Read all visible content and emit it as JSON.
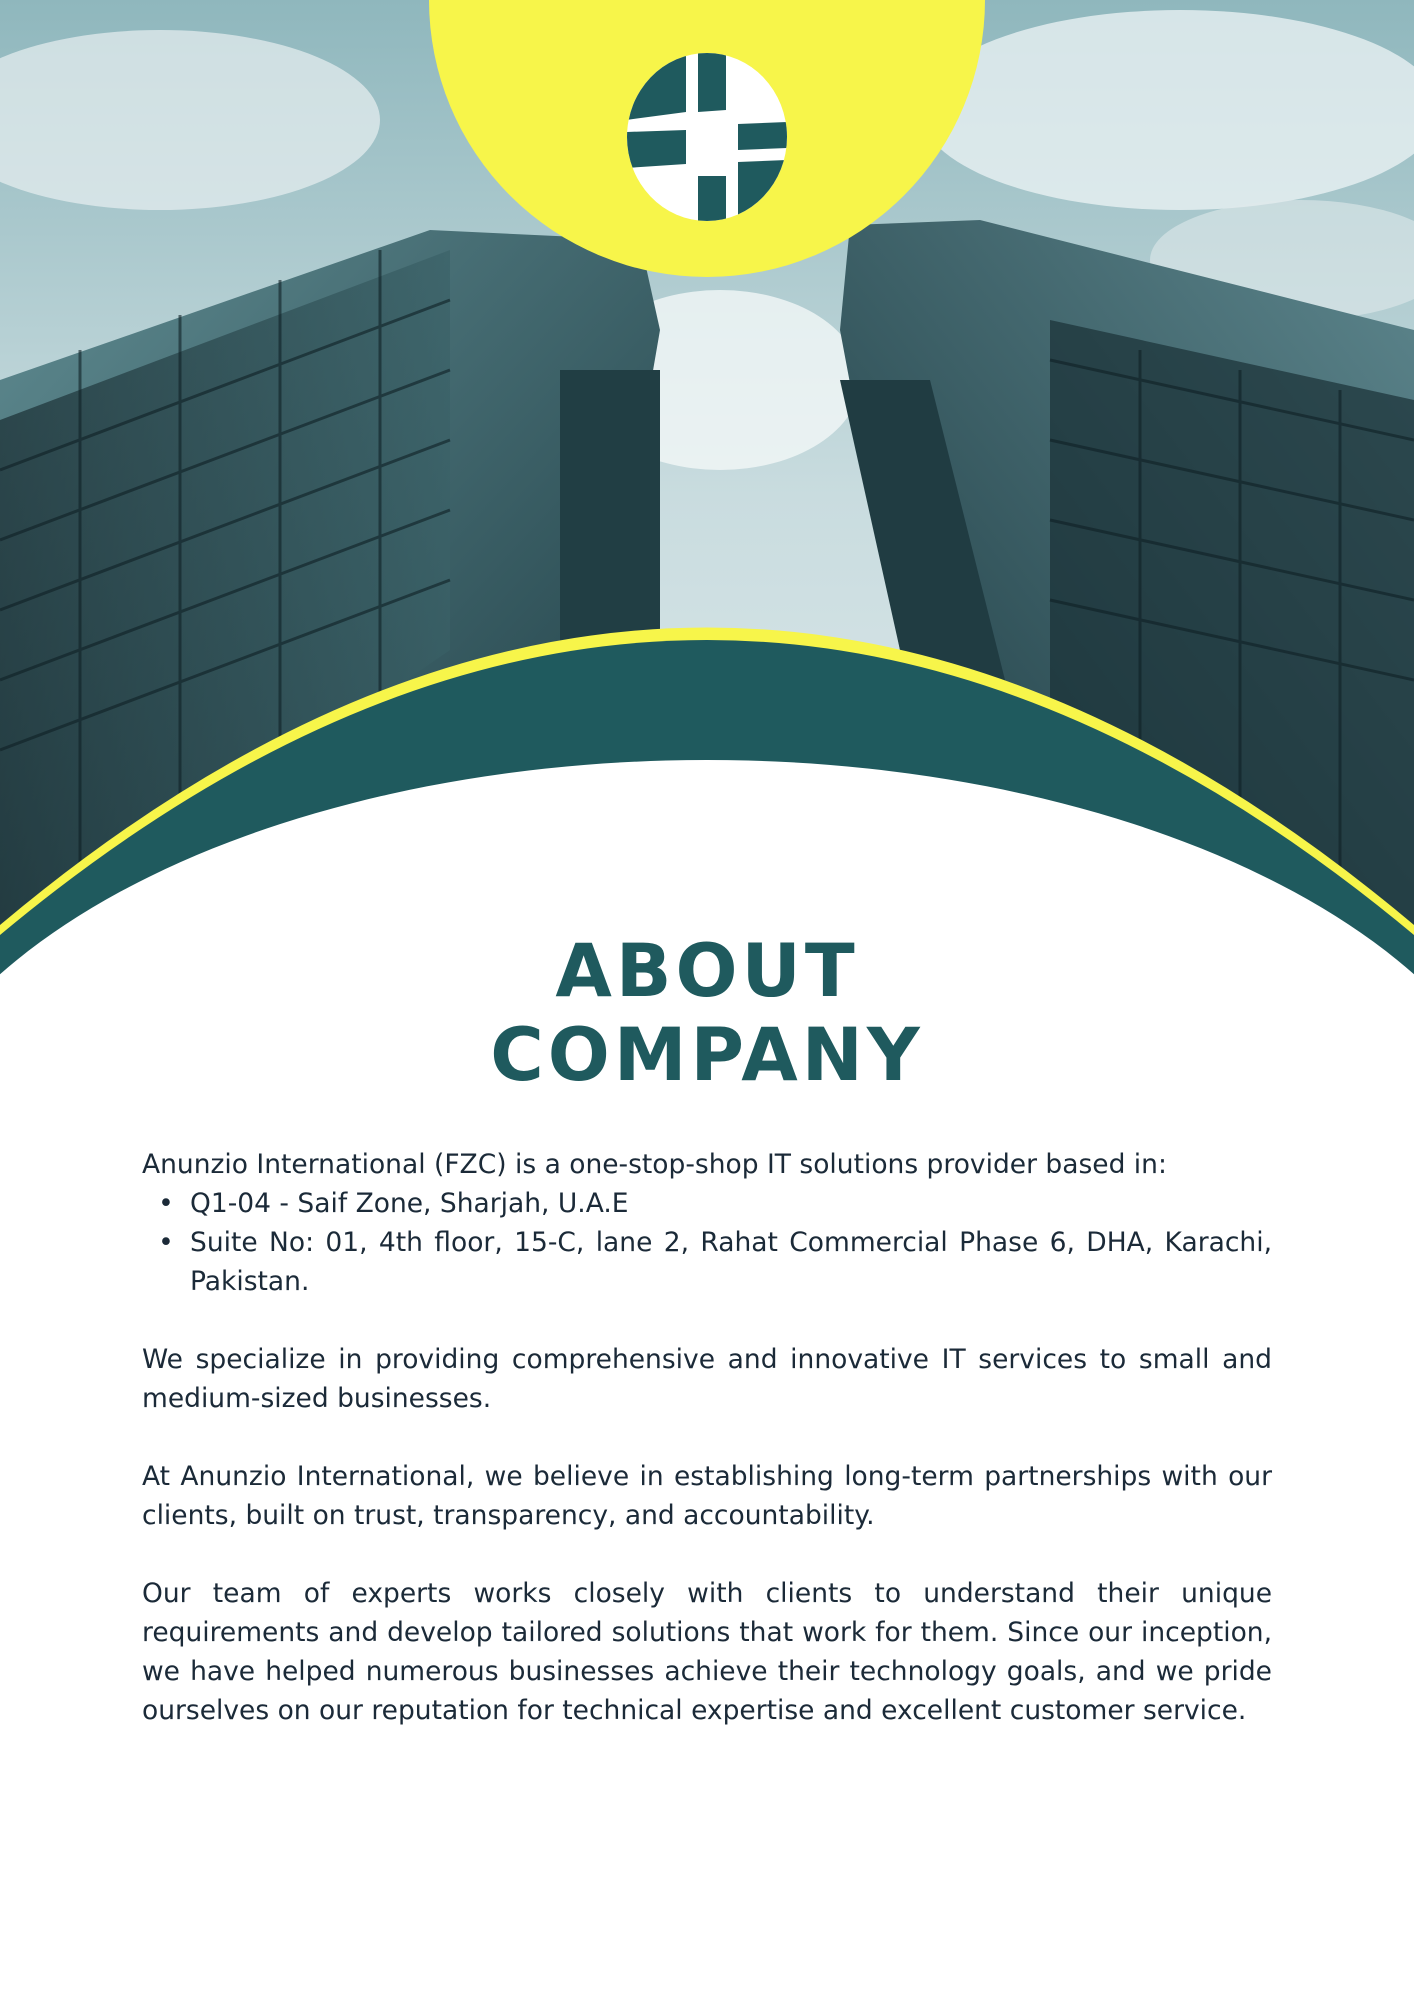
{
  "page": {
    "title_line1": "ABOUT",
    "title_line2": "COMPANY"
  },
  "intro": "Anunzio International (FZC) is a one-stop-shop IT solutions provider based in:",
  "locations": [
    "Q1-04 - Saif Zone, Sharjah, U.A.E",
    "Suite No: 01, 4th floor, 15-C, lane 2, Rahat Commercial Phase 6, DHA, Karachi, Pakistan."
  ],
  "paragraphs": [
    "We specialize in providing comprehensive and innovative IT services to small and medium-sized businesses.",
    "At Anunzio International, we believe in establishing long-term partnerships with our clients, built on trust, transparency, and accountability.",
    "Our team of experts works closely with clients to understand their unique requirements and develop tailored solutions that work for them. Since our inception, we have helped numerous businesses achieve their technology goals, and we pride ourselves on our reputation for technical expertise and excellent customer service."
  ],
  "colors": {
    "brand_teal": "#1f5a5e",
    "accent_yellow": "#f7f54a",
    "text": "#1b2a38"
  },
  "icons": {
    "logo": "globe-grid-icon",
    "bullet": "•"
  }
}
